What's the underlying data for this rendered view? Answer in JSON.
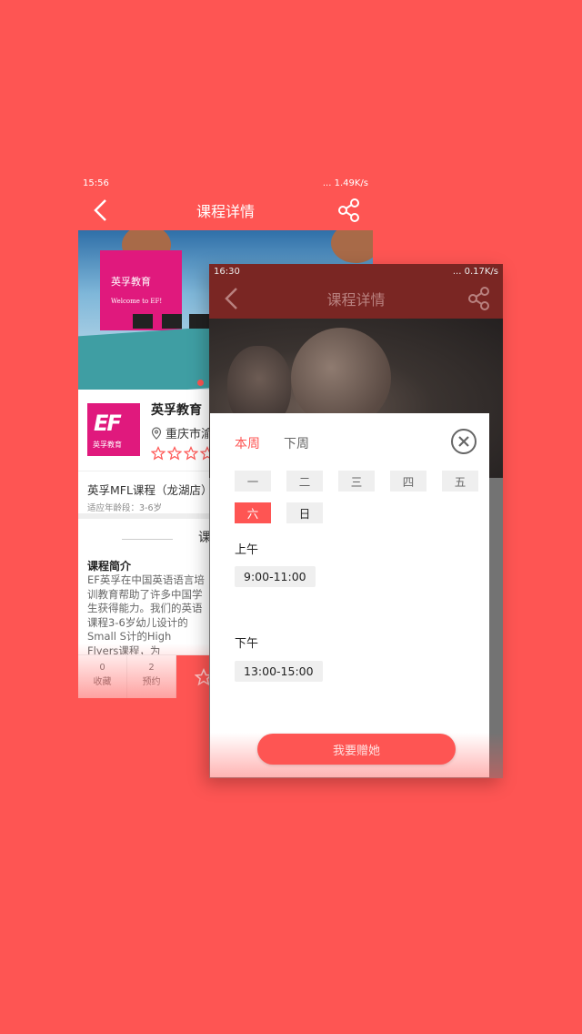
{
  "colors": {
    "accent": "#fe5553",
    "back_header": "#fe5553",
    "front_header": "#7a2623"
  },
  "back_screen": {
    "status": {
      "time": "15:56",
      "speed": "... 1.49K/s"
    },
    "title": "课程详情",
    "org": {
      "name": "英孚教育",
      "address": "重庆市渝",
      "logo_text": "EF",
      "logo_sub": "英孚教育"
    },
    "banner": {
      "brand_text": "英孚教育",
      "welcome_text": "Welcome to EF!"
    },
    "course": {
      "name": "英孚MFL课程（龙湖店）",
      "age": "适应年龄段：3-6岁"
    },
    "intro_heading": "课",
    "intro_title": "课程简介",
    "intro_body": "EF英孚在中国英语语言培训教育帮助了许多中国学生获得能力。我们的英语课程3-6岁幼儿设计的Small S计的High Flyers课程，为Trailblazers课程，还有",
    "bottom_bar": {
      "favorites_count": "0",
      "favorites_label": "收藏",
      "booking_count": "2",
      "booking_label": "预约"
    }
  },
  "front_screen": {
    "status": {
      "time": "16:30",
      "speed": "... 0.17K/s"
    },
    "title": "课程详情",
    "modal": {
      "tab_this_week": "本周",
      "tab_next_week": "下周",
      "days": [
        "一",
        "二",
        "三",
        "四",
        "五",
        "六",
        "日"
      ],
      "selected_day": "六",
      "morning_label": "上午",
      "morning_slot": "9:00-11:00",
      "afternoon_label": "下午",
      "afternoon_slot": "13:00-15:00",
      "button_label": "我要赠她"
    }
  }
}
